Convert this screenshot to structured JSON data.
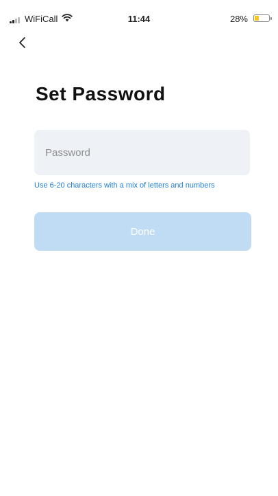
{
  "status_bar": {
    "carrier": "WiFiCall",
    "time": "11:44",
    "battery": "28%",
    "battery_level": 0.28,
    "signal_icon": "cellular-signal",
    "wifi_icon": "wifi",
    "battery_icon": "battery"
  },
  "nav": {
    "back_icon": "chevron-left"
  },
  "page": {
    "title": "Set Password"
  },
  "form": {
    "password_value": "",
    "password_placeholder": "Password",
    "hint": "Use 6-20 characters with a mix of letters and numbers",
    "done_label": "Done",
    "done_enabled": false
  },
  "colors": {
    "accent": "#1f7ed8",
    "button_disabled_bg": "#bfdcf4",
    "field_bg": "#eef2f7",
    "battery_fill": "#f5c518",
    "signal_active": "#222222",
    "signal_inactive": "#bbbbbb"
  }
}
